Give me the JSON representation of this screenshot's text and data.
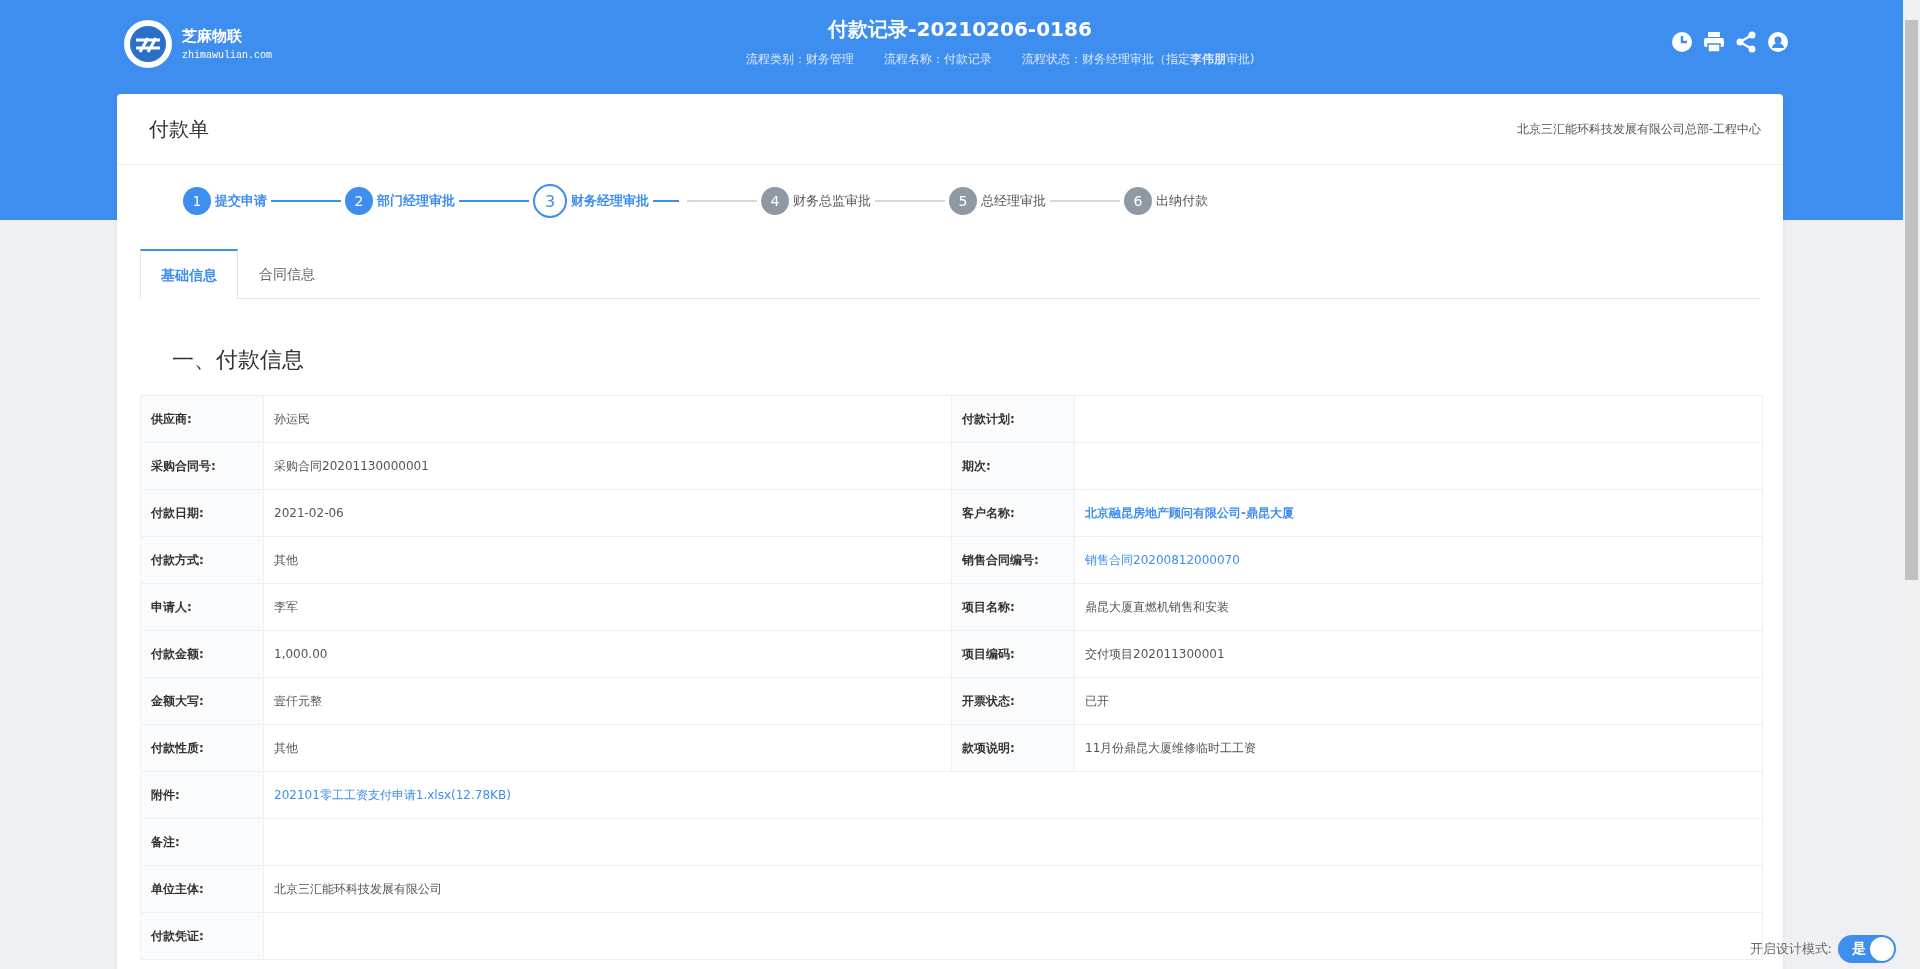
{
  "header": {
    "logo_name": "芝麻物联",
    "logo_domain": "zhimawulian.com",
    "title": "付款记录-20210206-0186",
    "meta": [
      "流程类别：财务管理",
      "流程名称：付款记录",
      "流程状态：财务经理审批（指定**李伟朋**审批)"
    ]
  },
  "card": {
    "title": "付款单",
    "org": "北京三汇能环科技发展有限公司总部-工程中心"
  },
  "steps": [
    {
      "number": "1",
      "label": "提交申请",
      "done": true,
      "current": false
    },
    {
      "number": "2",
      "label": "部门经理审批",
      "done": true,
      "current": false
    },
    {
      "number": "3",
      "label": "财务经理审批",
      "done": false,
      "current": true
    },
    {
      "number": "4",
      "label": "财务总监审批",
      "done": false,
      "current": false
    },
    {
      "number": "5",
      "label": "总经理审批",
      "done": false,
      "current": false
    },
    {
      "number": "6",
      "label": "出纳付款",
      "done": false,
      "current": false
    }
  ],
  "tabs": [
    {
      "label": "基础信息",
      "selected": true
    },
    {
      "label": "合同信息",
      "selected": false
    }
  ],
  "section_title": "一、付款信息",
  "rows": [
    {
      "cells": [
        {
          "label": "供应商:",
          "value": "孙运民",
          "kind": "text"
        },
        {
          "label": "付款计划:"
        }
      ]
    },
    {
      "cells": [
        {
          "label": "采购合同号:",
          "value": "采购合同20201130000001",
          "kind": "text"
        },
        {
          "label": "期次:"
        }
      ]
    },
    {
      "cells": [
        {
          "label": "付款日期:",
          "value": "2021-02-06",
          "kind": "text"
        },
        {
          "label": "客户名称:",
          "value": "北京融昆房地产顾问有限公司-鼎昆大厦",
          "kind": "strong-link"
        }
      ]
    },
    {
      "cells": [
        {
          "label": "付款方式:",
          "value": "其他",
          "kind": "text"
        },
        {
          "label": "销售合同编号:",
          "value": "销售合同20200812000070",
          "kind": "link"
        }
      ]
    },
    {
      "cells": [
        {
          "label": "申请人:",
          "value": "李军",
          "kind": "text"
        },
        {
          "label": "项目名称:",
          "value": "鼎昆大厦直燃机销售和安装",
          "kind": "text"
        }
      ]
    },
    {
      "cells": [
        {
          "label": "付款金额:",
          "value": "1,000.00",
          "kind": "text"
        },
        {
          "label": "项目编码:",
          "value": "交付项目202011300001",
          "kind": "text"
        }
      ]
    },
    {
      "cells": [
        {
          "label": "金额大写:",
          "value": "壹仟元整",
          "kind": "text"
        },
        {
          "label": "开票状态:",
          "value": "已开",
          "kind": "text"
        }
      ]
    },
    {
      "cells": [
        {
          "label": "付款性质:",
          "value": "其他",
          "kind": "text"
        },
        {
          "label": "款项说明:",
          "value": "11月份鼎昆大厦维修临时工工资",
          "kind": "text"
        }
      ]
    },
    {
      "cells": [
        {
          "label": "附件:",
          "value": "202101零工工资支付申请1.xlsx(12.78KB)",
          "kind": "link"
        }
      ]
    },
    {
      "cells": [
        {
          "label": "备注:"
        }
      ]
    },
    {
      "cells": [
        {
          "label": "单位主体:",
          "value": "北京三汇能环科技发展有限公司",
          "kind": "text"
        }
      ]
    },
    {
      "cells": [
        {
          "label": "付款凭证:"
        }
      ]
    }
  ],
  "design_mode": {
    "label": "开启设计模式:",
    "toggle_text": "是",
    "on": true
  }
}
